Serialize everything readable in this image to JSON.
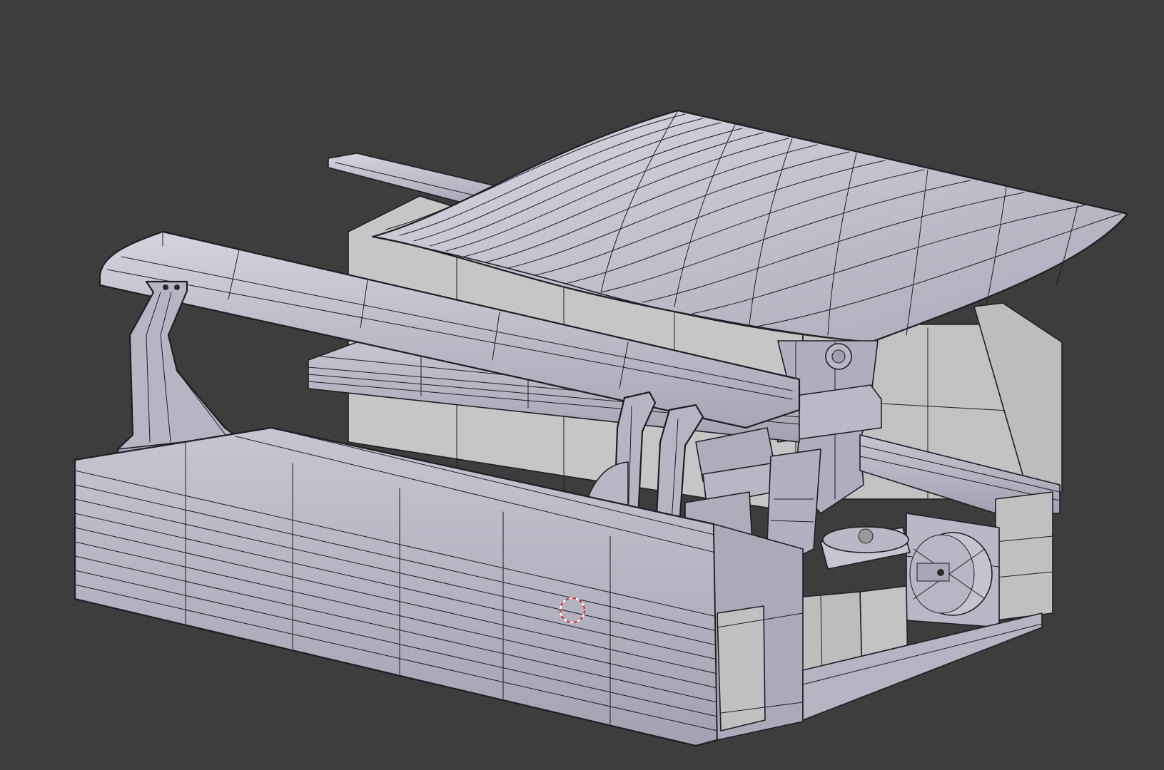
{
  "viewport": {
    "background_color": "#3d3d3d",
    "model_face_color": "#b9b9c6",
    "model_face_light": "#d2d2dc",
    "model_face_dark": "#9c9cab",
    "wall_color": "#c8c8c8",
    "wire_color": "#1e1e24",
    "cursor_color": "#e02020"
  }
}
